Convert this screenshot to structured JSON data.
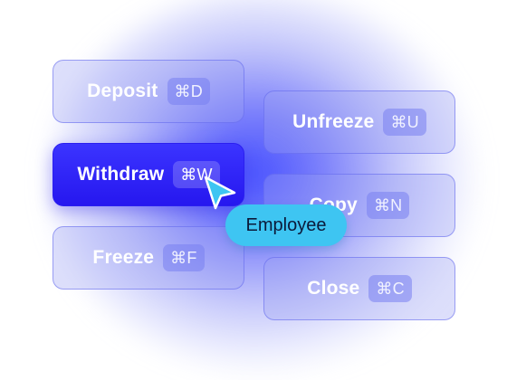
{
  "buttons": {
    "deposit": {
      "label": "Deposit",
      "shortcut": "⌘D"
    },
    "withdraw": {
      "label": "Withdraw",
      "shortcut": "⌘W"
    },
    "freeze": {
      "label": "Freeze",
      "shortcut": "⌘F"
    },
    "unfreeze": {
      "label": "Unfreeze",
      "shortcut": "⌘U"
    },
    "copy": {
      "label": "Copy",
      "shortcut": "⌘N"
    },
    "close": {
      "label": "Close",
      "shortcut": "⌘C"
    }
  },
  "cursor": {
    "icon": "pointer-cursor-icon",
    "color": "#3ec5f2"
  },
  "cursor_tag": {
    "label": "Employee"
  },
  "colors": {
    "active_button": "#2e22f5",
    "inactive_button": "#9aa0f3",
    "cursor_tag": "#3ec5f2",
    "glow": "#3c46ff"
  }
}
